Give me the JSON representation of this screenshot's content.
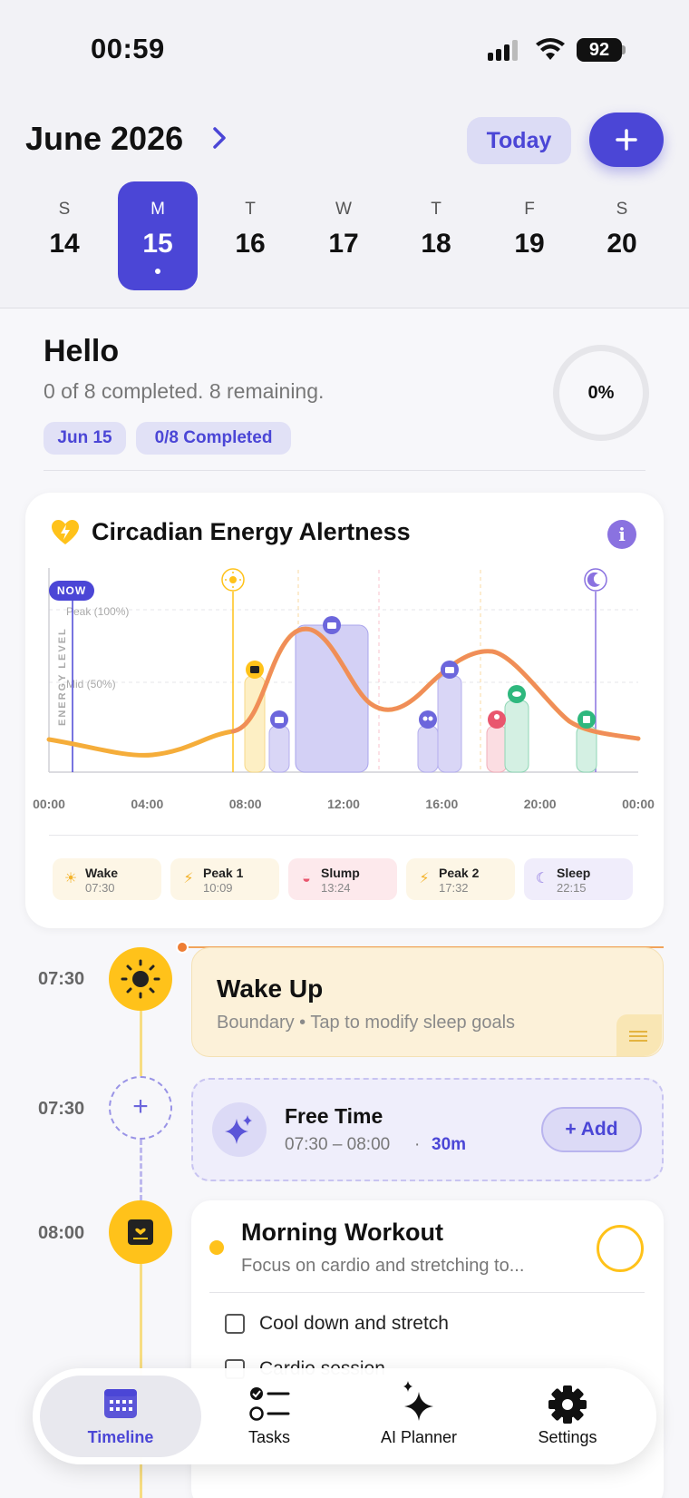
{
  "status_bar": {
    "time": "00:59",
    "battery": "92"
  },
  "header": {
    "month": "June 2026",
    "today_label": "Today",
    "add_label": "+"
  },
  "week": [
    {
      "letter": "S",
      "num": "14",
      "selected": false
    },
    {
      "letter": "M",
      "num": "15",
      "selected": true
    },
    {
      "letter": "T",
      "num": "16",
      "selected": false
    },
    {
      "letter": "W",
      "num": "17",
      "selected": false
    },
    {
      "letter": "T",
      "num": "18",
      "selected": false
    },
    {
      "letter": "F",
      "num": "19",
      "selected": false
    },
    {
      "letter": "S",
      "num": "20",
      "selected": false
    }
  ],
  "summary": {
    "title": "Hello",
    "subtitle": "0 of 8 completed. 8 remaining.",
    "date_chip": "Jun 15",
    "completed_chip": "0/8 Completed",
    "progress_label": "0%",
    "progress": 0
  },
  "energy": {
    "title": "Circadian Energy Alertness",
    "now_label": "NOW",
    "y_axis_label": "ENERGY LEVEL",
    "peak_label": "Peak (100%)",
    "mid_label": "Mid (50%)",
    "x_ticks": [
      "00:00",
      "04:00",
      "08:00",
      "12:00",
      "16:00",
      "20:00",
      "00:00"
    ],
    "legend": [
      {
        "name": "Wake",
        "time": "07:30",
        "icon": "sun-icon",
        "bg": "#fdf6e6",
        "color": "#f3b32b"
      },
      {
        "name": "Peak 1",
        "time": "10:09",
        "icon": "bolt-icon",
        "bg": "#fdf6e6",
        "color": "#f3b32b"
      },
      {
        "name": "Slump",
        "time": "13:24",
        "icon": "bed-icon",
        "bg": "#fde9ec",
        "color": "#e9566e"
      },
      {
        "name": "Peak 2",
        "time": "17:32",
        "icon": "bolt-icon",
        "bg": "#fdf6e6",
        "color": "#f3b32b"
      },
      {
        "name": "Sleep",
        "time": "22:15",
        "icon": "moon-icon",
        "bg": "#f0edfb",
        "color": "#8a72e0"
      }
    ]
  },
  "timeline": {
    "wake": {
      "time": "07:30",
      "title": "Wake Up",
      "subtitle": "Boundary • Tap to modify sleep goals"
    },
    "free": {
      "time": "07:30",
      "title": "Free Time",
      "range": "07:30 – 08:00",
      "sep": "·",
      "duration": "30m",
      "add_label": "+ Add"
    },
    "workout": {
      "time": "08:00",
      "title": "Morning Workout",
      "subtitle": "Focus on cardio and stretching to...",
      "subtasks": [
        "Cool down and stretch",
        "Cardio session"
      ]
    }
  },
  "nav": [
    {
      "label": "Timeline",
      "icon": "calendar-icon",
      "active": true
    },
    {
      "label": "Tasks",
      "icon": "checklist-icon",
      "active": false
    },
    {
      "label": "AI Planner",
      "icon": "sparkles-icon",
      "active": false
    },
    {
      "label": "Settings",
      "icon": "gear-icon",
      "active": false
    }
  ],
  "colors": {
    "accent": "#4b46d6",
    "amber": "#ffc21a",
    "curve": "#f08a5d"
  }
}
